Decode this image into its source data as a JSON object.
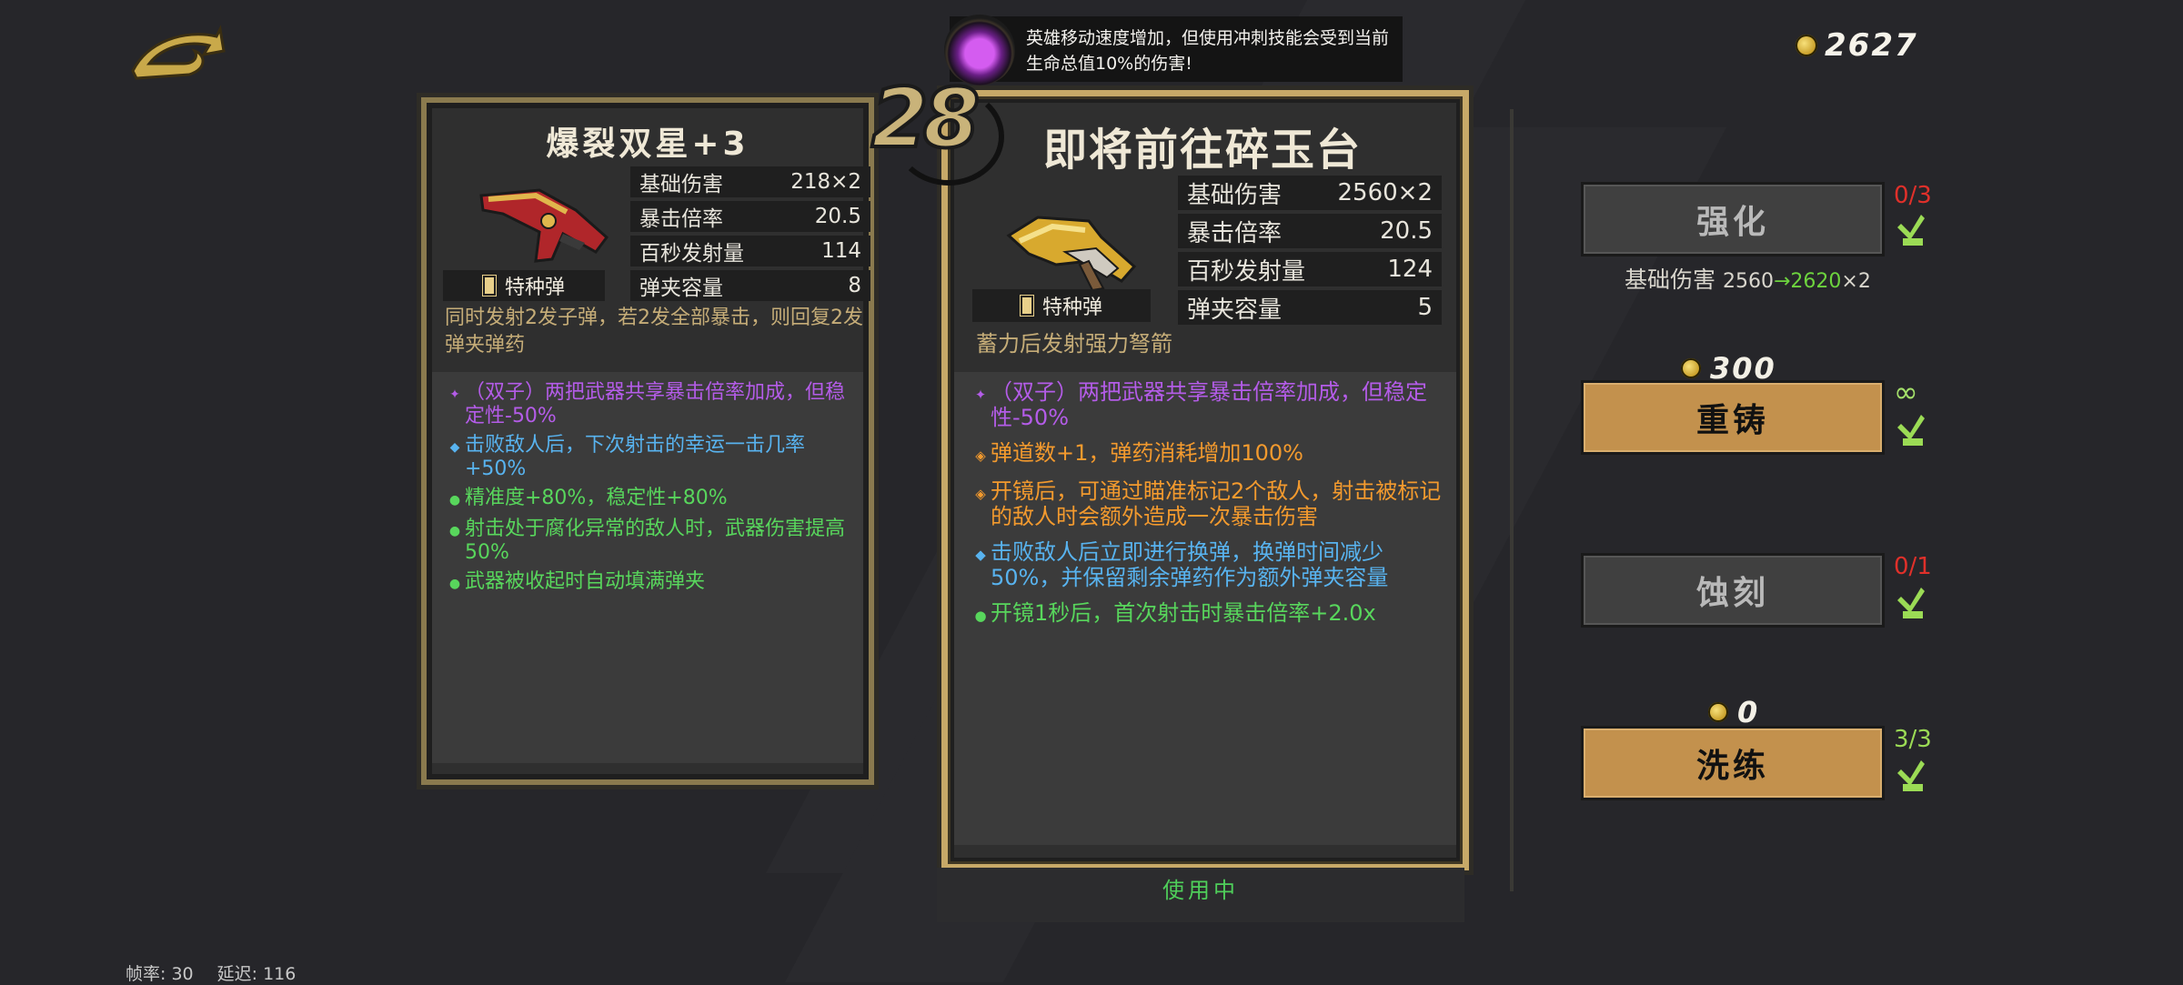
{
  "event": {
    "text": "英雄移动速度增加，但使用冲刺技能会受到当前生命总值10%的伤害!",
    "icon": "purple-flame-icon"
  },
  "currency": {
    "coins": "2627"
  },
  "level": "28",
  "destination_title": "即将前往碎玉台",
  "card_left": {
    "title": "爆裂双星+3",
    "tag": "特种弹",
    "stats": [
      {
        "label": "基础伤害",
        "value": "218×2"
      },
      {
        "label": "暴击倍率",
        "value": "20.5"
      },
      {
        "label": "百秒发射量",
        "value": "114"
      },
      {
        "label": "弹夹容量",
        "value": "8"
      }
    ],
    "description": "同时发射2发子弹，若2发全部暴击，则回复2发弹夹弹药",
    "traits": [
      {
        "color": "purple",
        "bullet": "✦",
        "text": "（双子）两把武器共享暴击倍率加成，但稳定性-50%"
      },
      {
        "color": "blue",
        "bullet": "◆",
        "text": "击败敌人后，下次射击的幸运一击几率+50%"
      },
      {
        "color": "green",
        "bullet": "●",
        "text": "精准度+80%，稳定性+80%"
      },
      {
        "color": "green",
        "bullet": "●",
        "text": "射击处于腐化异常的敌人时，武器伤害提高50%"
      },
      {
        "color": "green",
        "bullet": "●",
        "text": "武器被收起时自动填满弹夹"
      }
    ]
  },
  "card_right": {
    "tag": "特种弹",
    "stats": [
      {
        "label": "基础伤害",
        "value": "2560×2"
      },
      {
        "label": "暴击倍率",
        "value": "20.5"
      },
      {
        "label": "百秒发射量",
        "value": "124"
      },
      {
        "label": "弹夹容量",
        "value": "5"
      }
    ],
    "description": "蓄力后发射强力弩箭",
    "traits": [
      {
        "color": "purple",
        "bullet": "✦",
        "text": "（双子）两把武器共享暴击倍率加成，但稳定性-50%"
      },
      {
        "color": "orange",
        "bullet": "◈",
        "text": "弹道数+1，弹药消耗增加100%"
      },
      {
        "color": "orange",
        "bullet": "◈",
        "text": "开镜后，可通过瞄准标记2个敌人，射击被标记的敌人时会额外造成一次暴击伤害"
      },
      {
        "color": "blue",
        "bullet": "◆",
        "text": "击败敌人后立即进行换弹，换弹时间减少50%，并保留剩余弹药作为额外弹夹容量"
      },
      {
        "color": "green",
        "bullet": "●",
        "text": "开镜1秒后，首次射击时暴击倍率+2.0x"
      }
    ],
    "status": "使用中"
  },
  "actions": {
    "upgrade": {
      "label": "强化",
      "count": "0/3",
      "preview": {
        "label": "基础伤害",
        "old": "2560",
        "arrow": "→",
        "new": "2620",
        "suffix": "×2"
      }
    },
    "reforge": {
      "label": "重铸",
      "count": "∞",
      "cost": "300"
    },
    "etch": {
      "label": "蚀刻",
      "count": "0/1"
    },
    "refine": {
      "label": "洗练",
      "count": "3/3",
      "cost": "0"
    }
  },
  "debug": {
    "fps": "帧率: 30",
    "latency": "延迟: 116"
  }
}
